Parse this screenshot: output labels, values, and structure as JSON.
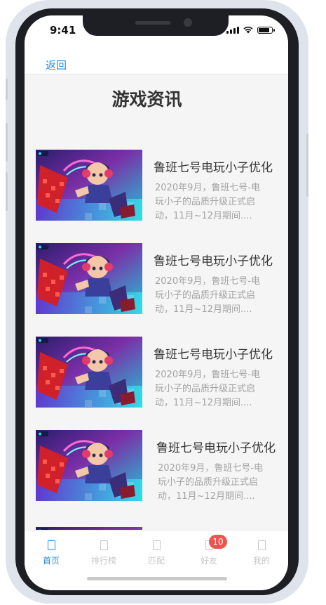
{
  "status_bar": {
    "time": "9:41"
  },
  "nav": {
    "back_label": "返回"
  },
  "page": {
    "title": "游戏资讯"
  },
  "news": [
    {
      "title": "鲁班七号电玩小子优化",
      "desc": "2020年9月，鲁班七号-电玩小子的品质升级正式启动，11月~12月期间...."
    },
    {
      "title": "鲁班七号电玩小子优化",
      "desc": "2020年9月，鲁班七号-电玩小子的品质升级正式启动，11月~12月期间...."
    },
    {
      "title": "鲁班七号电玩小子优化",
      "desc": "2020年9月，鲁班七号-电玩小子的品质升级正式启动，11月~12月期间...."
    },
    {
      "title": "鲁班七号电玩小子优化",
      "desc": "2020年9月，鲁班七号-电玩小子的品质升级正式启动，11月~12月期间...."
    }
  ],
  "tabs": [
    {
      "label": "首页",
      "icon": "home-icon",
      "active": true
    },
    {
      "label": "排行榜",
      "icon": "ranking-icon",
      "active": false
    },
    {
      "label": "匹配",
      "icon": "match-icon",
      "active": false
    },
    {
      "label": "好友",
      "icon": "friends-icon",
      "active": false,
      "badge": "10"
    },
    {
      "label": "我的",
      "icon": "profile-icon",
      "active": false
    }
  ],
  "colors": {
    "accent": "#2d8cdc",
    "badge": "#ef5350",
    "text_primary": "#333333",
    "text_secondary": "#a3a3a3"
  }
}
